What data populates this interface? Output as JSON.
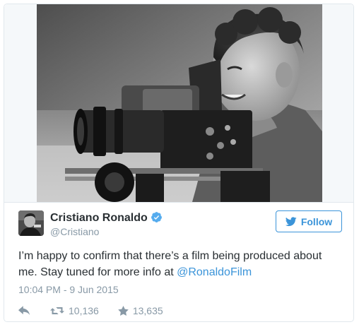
{
  "tweet": {
    "author": {
      "display_name": "Cristiano Ronaldo",
      "handle": "@Cristiano",
      "verified_icon": "verified-badge-icon",
      "avatar": "avatar"
    },
    "follow_button": {
      "label": "Follow",
      "icon": "twitter-bird-icon"
    },
    "text_before_mention": "I’m happy to confirm that there’s a film being produced about me. Stay tuned for more info at ",
    "mention": "@RonaldoFilm",
    "timestamp": "10:04 PM - 9 Jun 2015",
    "actions": {
      "reply_icon": "reply-icon",
      "retweet_icon": "retweet-icon",
      "retweet_count": "10,136",
      "favorite_icon": "star-icon",
      "favorite_count": "13,635"
    },
    "photo": {
      "description_icon": "tweet-photo"
    }
  },
  "colors": {
    "link": "#3b94d9",
    "text": "#292f33",
    "muted": "#8899a6",
    "border": "#e1e8ed",
    "verified": "#55acee"
  }
}
